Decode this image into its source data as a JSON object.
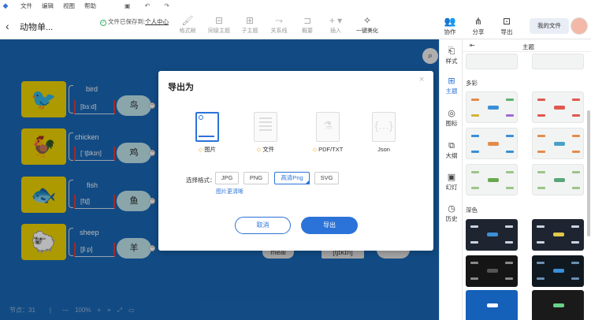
{
  "menubar": {
    "menus": [
      "文件",
      "编辑",
      "视图",
      "帮助"
    ]
  },
  "header": {
    "title": "动物单...",
    "saved_prefix": "文件已保存到:",
    "saved_location": "个人中心"
  },
  "toolbar": {
    "tools": [
      {
        "label": "格式刷",
        "icon": "format-brush-icon"
      },
      {
        "label": "同级主题",
        "icon": "sibling-topic-icon"
      },
      {
        "label": "子主题",
        "icon": "subtopic-icon"
      },
      {
        "label": "关系线",
        "icon": "relation-line-icon"
      },
      {
        "label": "概要",
        "icon": "summary-icon"
      },
      {
        "label": "插入",
        "icon": "insert-icon"
      },
      {
        "label": "一键美化",
        "icon": "magic-wand-icon"
      }
    ],
    "right": [
      {
        "label": "协作",
        "icon": "people-icon"
      },
      {
        "label": "分享",
        "icon": "share-icon"
      },
      {
        "label": "导出",
        "icon": "export-icon"
      }
    ],
    "my_files": "我的文件"
  },
  "mindmap": {
    "rows": [
      {
        "en": "bird",
        "ipa": "[bɜːd]",
        "cn": "鸟",
        "img": "🐦"
      },
      {
        "en": "chicken",
        "ipa": "[ˈtʃɪkɪn]",
        "cn": "鸡",
        "img": "🐓"
      },
      {
        "en": "fish",
        "ipa": "[fɪʃ]",
        "cn": "鱼",
        "img": "🐟"
      },
      {
        "en": "sheep",
        "ipa": "[ʃiːp]",
        "cn": "羊",
        "img": "🐑"
      }
    ],
    "partial_right": [
      "meal",
      "[tʃɪkɪn]"
    ]
  },
  "statusbar": {
    "count": "节点：31",
    "zoom": "100%"
  },
  "rail": [
    {
      "label": "样式",
      "icon": "style-icon"
    },
    {
      "label": "主题",
      "icon": "theme-icon"
    },
    {
      "label": "图标",
      "icon": "icons-icon"
    },
    {
      "label": "大纲",
      "icon": "outline-icon"
    },
    {
      "label": "幻灯",
      "icon": "slides-icon"
    },
    {
      "label": "历史",
      "icon": "history-icon"
    }
  ],
  "panel": {
    "title": "主题",
    "section_colorful": "多彩",
    "section_dark": "深色"
  },
  "dialog": {
    "title": "导出为",
    "formats": [
      {
        "label": "图片",
        "vip": true
      },
      {
        "label": "文件",
        "vip": true
      },
      {
        "label": "PDF/TXT",
        "vip": true
      },
      {
        "label": "Json",
        "vip": false
      }
    ],
    "options_label": "选择格式：",
    "options": [
      "JPG",
      "PNG",
      "高清Png",
      "SVG"
    ],
    "selected_option": "高清Png",
    "hint": "图片更清晰",
    "cancel": "取消",
    "export": "导出"
  },
  "colors": {
    "accent": "#2b73d8",
    "canvas": "#1a68b8",
    "node_img": "#f0d400",
    "node_cn": "#bfe6ee"
  }
}
